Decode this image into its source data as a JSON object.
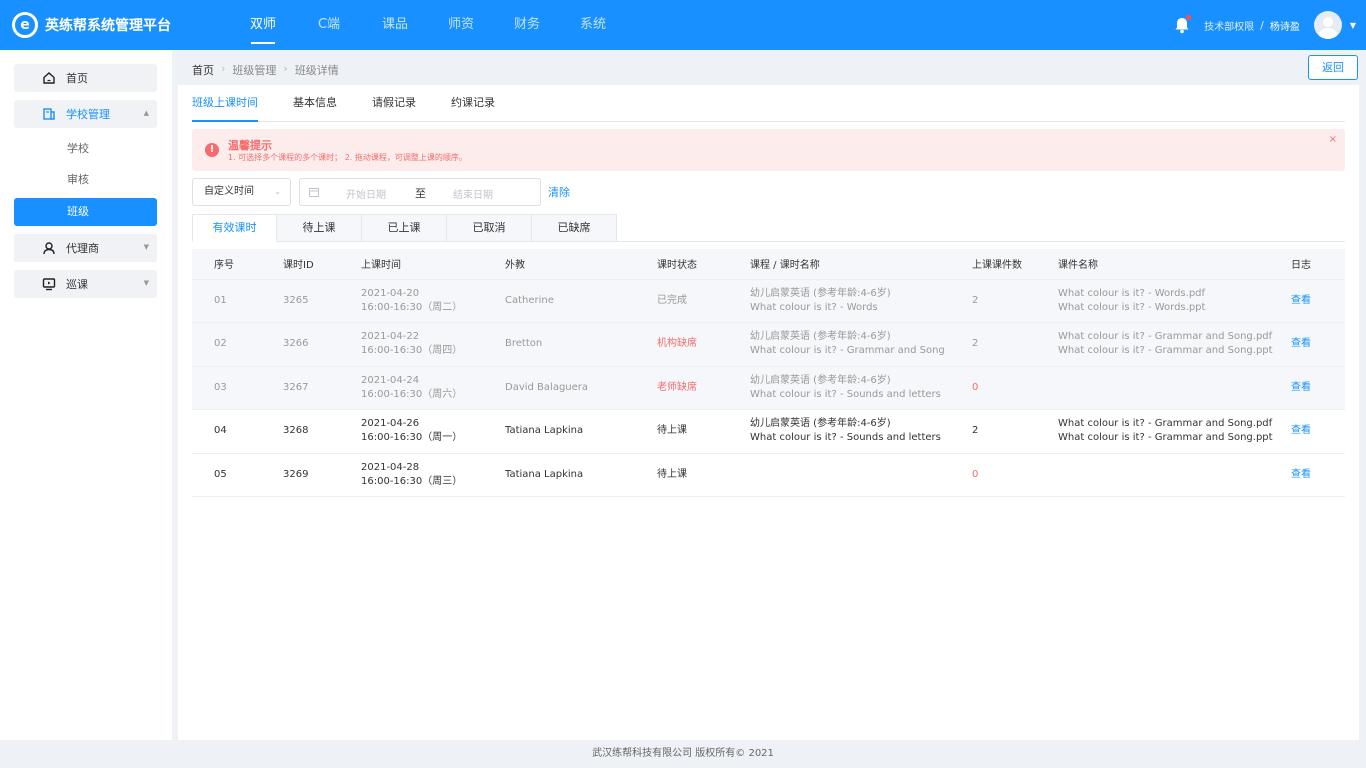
{
  "app": {
    "logo_letter": "e",
    "title": "英练帮系统管理平台"
  },
  "topnav": [
    {
      "label": "双师",
      "active": true
    },
    {
      "label": "C端",
      "active": false
    },
    {
      "label": "课品",
      "active": false
    },
    {
      "label": "师资",
      "active": false
    },
    {
      "label": "财务",
      "active": false
    },
    {
      "label": "系统",
      "active": false
    }
  ],
  "user": {
    "department": "技术部权限",
    "separator": "/",
    "name": "杨诗盈"
  },
  "sidebar": {
    "home": "首页",
    "school_mgmt": "学校管理",
    "sub": [
      "学校",
      "审核",
      "班级"
    ],
    "agent": "代理商",
    "patrol": "巡课"
  },
  "breadcrumb": [
    "首页",
    "班级管理",
    "班级详情"
  ],
  "back_label": "返回",
  "tabs": [
    "班级上课时间",
    "基本信息",
    "请假记录",
    "约课记录"
  ],
  "alert": {
    "title": "温馨提示",
    "desc": "1. 可选择多个课程的多个课时；   2. 拖动课程，可调整上课的顺序。",
    "close": "×"
  },
  "filter": {
    "select_value": "自定义时间",
    "start_placeholder": "开始日期",
    "to": "至",
    "end_placeholder": "结束日期",
    "clear": "清除"
  },
  "subtabs": [
    "有效课时",
    "待上课",
    "已上课",
    "已取消",
    "已缺席"
  ],
  "table": {
    "headers": [
      "序号",
      "课时ID",
      "上课时间",
      "外教",
      "课时状态",
      "课程 / 课时名称",
      "上课课件数",
      "课件名称",
      "日志"
    ],
    "rows": [
      {
        "no": "01",
        "id": "3265",
        "date": "2021-04-20",
        "time": "16:00-16:30（周二）",
        "teacher": "Catherine",
        "status": "已完成",
        "course1": "幼儿启蒙英语 (参考年龄:4-6岁)",
        "course2": "What colour is it? - Words",
        "count": "2",
        "file1": "What colour is it? - Words.pdf",
        "file2": "What colour is it? - Words.ppt",
        "log": "查看"
      },
      {
        "no": "02",
        "id": "3266",
        "date": "2021-04-22",
        "time": "16:00-16:30（周四）",
        "teacher": "Bretton",
        "status": "机构缺席",
        "course1": "幼儿启蒙英语 (参考年龄:4-6岁)",
        "course2": "What colour is it? - Grammar and Song",
        "count": "2",
        "file1": "What colour is it? - Grammar and Song.pdf",
        "file2": "What colour is it? - Grammar and Song.ppt",
        "log": "查看"
      },
      {
        "no": "03",
        "id": "3267",
        "date": "2021-04-24",
        "time": "16:00-16:30（周六）",
        "teacher": "David Balaguera",
        "status": "老师缺席",
        "course1": "幼儿启蒙英语 (参考年龄:4-6岁)",
        "course2": "What colour is it? - Sounds and letters",
        "count": "0",
        "file1": "",
        "file2": "",
        "log": "查看"
      },
      {
        "no": "04",
        "id": "3268",
        "date": "2021-04-26",
        "time": "16:00-16:30（周一）",
        "teacher": "Tatiana Lapkina",
        "status": "待上课",
        "course1": "幼儿启蒙英语 (参考年龄:4-6岁)",
        "course2": "What colour is it? - Sounds and letters",
        "count": "2",
        "file1": "What colour is it? - Grammar and Song.pdf",
        "file2": "What colour is it? - Grammar and Song.ppt",
        "log": "查看"
      },
      {
        "no": "05",
        "id": "3269",
        "date": "2021-04-28",
        "time": "16:00-16:30（周三）",
        "teacher": "Tatiana Lapkina",
        "status": "待上课",
        "course1": "",
        "course2": "",
        "count": "0",
        "file1": "",
        "file2": "",
        "log": "查看"
      }
    ]
  },
  "footer": "武汉练帮科技有限公司 版权所有© 2021",
  "colors": {
    "primary": "#1890ff",
    "danger": "#f56c6c"
  }
}
